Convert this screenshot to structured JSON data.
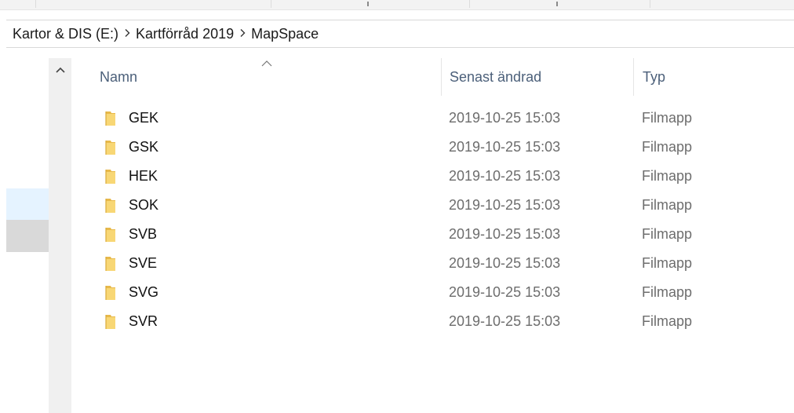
{
  "address": {
    "crumbs": [
      "Kartor & DIS (E:)",
      "Kartförråd 2019",
      "MapSpace"
    ]
  },
  "columns": {
    "name": "Namn",
    "modified": "Senast ändrad",
    "type": "Typ"
  },
  "rows": [
    {
      "name": "GEK",
      "modified": "2019-10-25 15:03",
      "type": "Filmapp"
    },
    {
      "name": "GSK",
      "modified": "2019-10-25 15:03",
      "type": "Filmapp"
    },
    {
      "name": "HEK",
      "modified": "2019-10-25 15:03",
      "type": "Filmapp"
    },
    {
      "name": "SOK",
      "modified": "2019-10-25 15:03",
      "type": "Filmapp"
    },
    {
      "name": "SVB",
      "modified": "2019-10-25 15:03",
      "type": "Filmapp"
    },
    {
      "name": "SVE",
      "modified": "2019-10-25 15:03",
      "type": "Filmapp"
    },
    {
      "name": "SVG",
      "modified": "2019-10-25 15:03",
      "type": "Filmapp"
    },
    {
      "name": "SVR",
      "modified": "2019-10-25 15:03",
      "type": "Filmapp"
    }
  ],
  "icons": {
    "folder": "folder-icon",
    "breadcrumb_separator": "chevron-right-icon",
    "sort": "sort-ascending-icon",
    "scroll_up": "chevron-up-icon"
  },
  "colors": {
    "folder": "#f8d775",
    "header_text": "#4c607a",
    "hover": "#e5f3ff",
    "selected": "#d9d9d9"
  }
}
